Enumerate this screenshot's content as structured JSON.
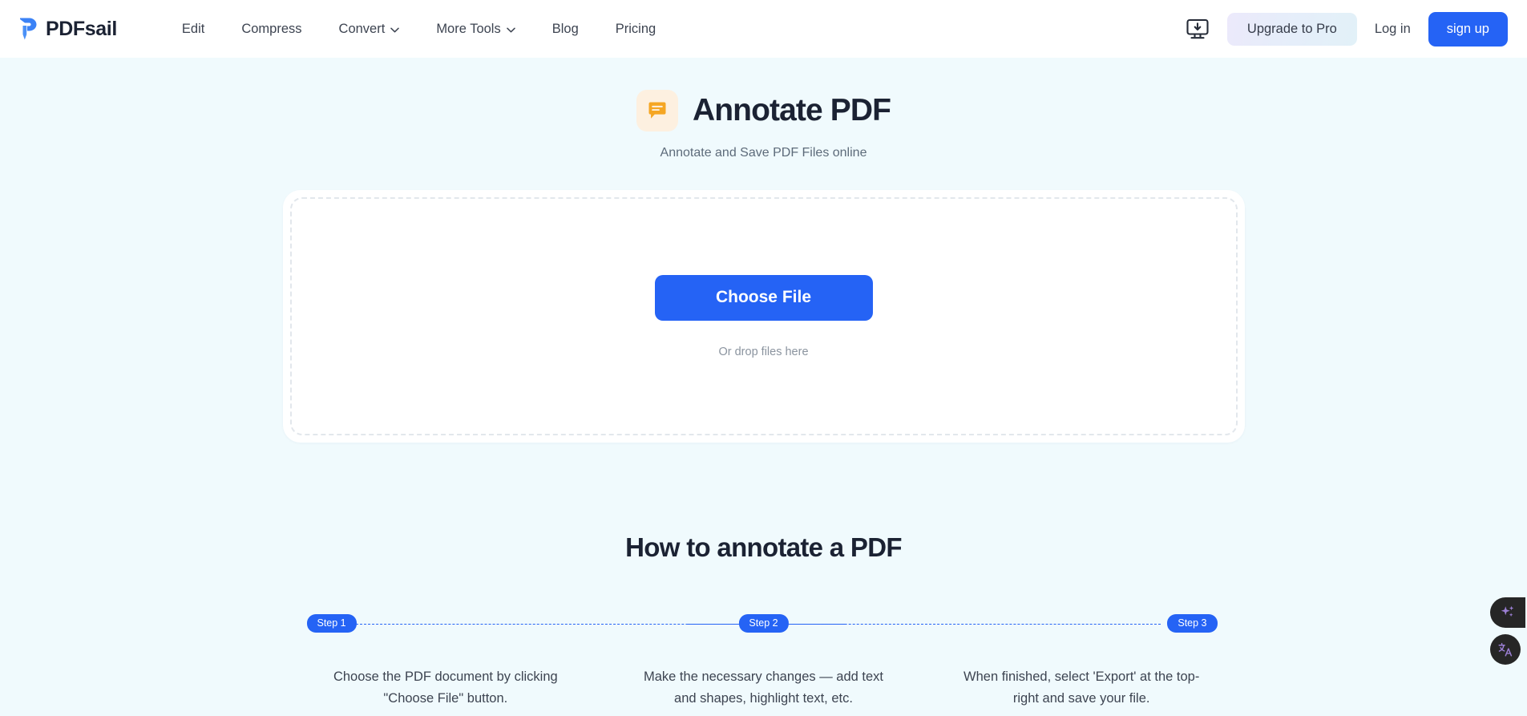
{
  "brand": {
    "name": "PDFsail",
    "logo_icon": "pdfsail-pen-logo-icon"
  },
  "nav": {
    "items": [
      {
        "label": "Edit",
        "has_chevron": false
      },
      {
        "label": "Compress",
        "has_chevron": false
      },
      {
        "label": "Convert",
        "has_chevron": true
      },
      {
        "label": "More Tools",
        "has_chevron": true
      },
      {
        "label": "Blog",
        "has_chevron": false
      },
      {
        "label": "Pricing",
        "has_chevron": false
      }
    ]
  },
  "header_actions": {
    "desktop_app_icon": "monitor-download-icon",
    "upgrade_label": "Upgrade to Pro",
    "login_label": "Log in",
    "signup_label": "sign up"
  },
  "hero": {
    "icon": "comment-annotate-icon",
    "title": "Annotate PDF",
    "subtitle": "Annotate and Save PDF Files online"
  },
  "dropzone": {
    "choose_label": "Choose File",
    "drop_hint": "Or drop files here"
  },
  "howto": {
    "title": "How to annotate a PDF",
    "steps": [
      {
        "badge": "Step 1",
        "text": "Choose the PDF document by clicking \"Choose File\" button."
      },
      {
        "badge": "Step 2",
        "text": "Make the necessary changes — add text and shapes, highlight text, etc."
      },
      {
        "badge": "Step 3",
        "text": "When finished, select 'Export' at the top-right and save your file."
      }
    ]
  },
  "floating_buttons": [
    {
      "icon": "sparkles-ai-icon"
    },
    {
      "icon": "translate-language-icon"
    }
  ],
  "colors": {
    "page_background": "#f0fafd",
    "primary_blue": "#2563f5",
    "hero_icon_bg": "#fdf0e0",
    "hero_icon_fg": "#f5a623",
    "text_dark": "#1b2233",
    "text_body": "#3d4451",
    "text_muted": "#8b949f",
    "fab_background": "#262626",
    "fab_icon": "#9b7fd4"
  }
}
